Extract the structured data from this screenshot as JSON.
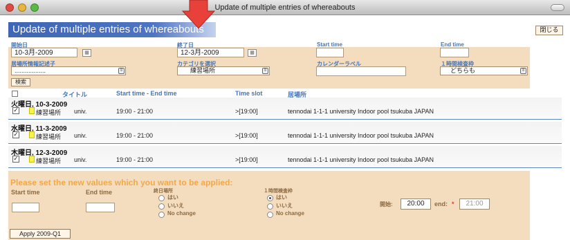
{
  "window": {
    "title": "Update of multiple entries of whereabouts"
  },
  "page": {
    "heading": "Update of multiple entries of whereabouts",
    "close_label": "閉じる"
  },
  "search": {
    "start_date_label": "開始日",
    "start_date": "10-3月-2009",
    "end_date_label": "終了日",
    "end_date": "12-3月-2009",
    "start_time_label": "Start time",
    "end_time_label": "End time",
    "descriptor_label": "居場所情報記述子",
    "descriptor_value": "..................",
    "category_label": "カテゴリを選択",
    "category_value": "練習場所",
    "calendar_label_label": "カレンダーラベル",
    "onehour_label": "１時間検査枠",
    "onehour_value": "どちらも",
    "search_button": "検索",
    "cal_icon_glyph": "▦",
    "select_arrow_glyph": "⇳"
  },
  "table": {
    "headers": [
      "タイトル",
      "Start time - End time",
      "Time slot",
      "居場所"
    ],
    "rows": [
      {
        "day": "火曜日, 10-3-2009",
        "category": "練習場所",
        "title": "univ.",
        "time": "19:00 - 21:00",
        "slot": ">[19:00]",
        "place": "tennodai 1-1-1 university Indoor pool tsukuba JAPAN",
        "checked": "✓"
      },
      {
        "day": "水曜日, 11-3-2009",
        "category": "練習場所",
        "title": "univ.",
        "time": "19:00 - 21:00",
        "slot": ">[19:00]",
        "place": "tennodai 1-1-1 university Indoor pool tsukuba JAPAN",
        "checked": "✓"
      },
      {
        "day": "木曜日, 12-3-2009",
        "category": "練習場所",
        "title": "univ.",
        "time": "19:00 - 21:00",
        "slot": ">[19:00]",
        "place": "tennodai 1-1-1 university Indoor pool tsukuba JAPAN",
        "checked": "✓"
      }
    ]
  },
  "bulk": {
    "title": "Please set the new values which you want to be applied:",
    "start_time_label": "Start time",
    "end_time_label": "End time",
    "allday_label": "終日場所",
    "allday_options": [
      "はい",
      "いいえ",
      "No change"
    ],
    "onehour_label": "１時間検査枠",
    "onehour_options": [
      "はい",
      "いいえ",
      "No change"
    ],
    "begin_label": "開始:",
    "begin_value": "20:00",
    "end_label": "end:",
    "required_mark": "*",
    "end_value": "21:00",
    "apply_button": "Apply 2009-Q1"
  },
  "colors": {
    "accent_blue": "#4676b8",
    "panel": "#f4dcbf",
    "orange_title": "#f0a94a",
    "arrow_red": "#e8413a"
  }
}
